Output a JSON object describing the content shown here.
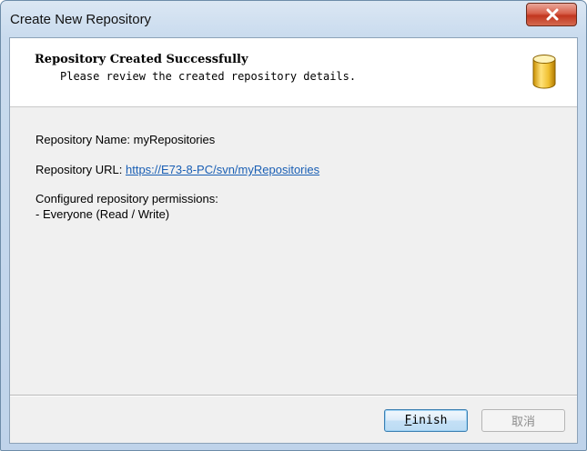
{
  "window": {
    "title": "Create New Repository"
  },
  "header": {
    "title": "Repository Created Successfully",
    "subtitle": "Please review the created repository details.",
    "icon": "database-icon"
  },
  "details": {
    "name_label": "Repository Name: ",
    "name_value": "myRepositories",
    "url_label": "Repository URL: ",
    "url_value": "https://E73-8-PC/svn/myRepositories",
    "permissions_label": "Configured repository permissions:",
    "permissions_value": "- Everyone (Read / Write)"
  },
  "buttons": {
    "finish_first": "F",
    "finish_rest": "inish",
    "cancel": "取消"
  },
  "colors": {
    "link": "#1a5fb4",
    "close_button": "#c2361f",
    "icon_gold": "#e8b617"
  }
}
